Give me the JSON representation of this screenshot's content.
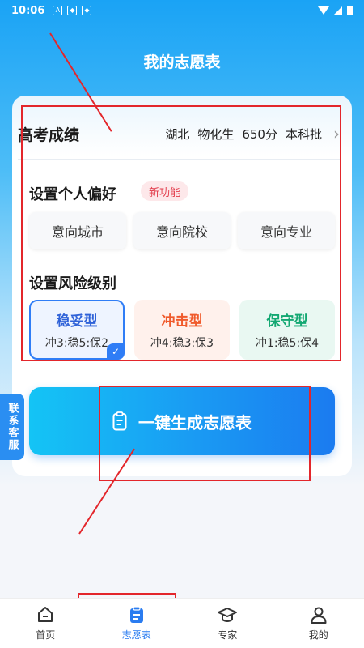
{
  "status_bar": {
    "time": "10:06"
  },
  "page_title": "我的志愿表",
  "score": {
    "label": "高考成绩",
    "province": "湖北",
    "subjects": "物化生",
    "points": "650分",
    "batch": "本科批"
  },
  "preferences": {
    "title": "设置个人偏好",
    "badge": "新功能",
    "options": [
      "意向城市",
      "意向院校",
      "意向专业"
    ]
  },
  "risk": {
    "title": "设置风险级别",
    "levels": [
      {
        "name": "稳妥型",
        "ratio": "冲3:稳5:保2",
        "selected": true
      },
      {
        "name": "冲击型",
        "ratio": "冲4:稳3:保3",
        "selected": false
      },
      {
        "name": "保守型",
        "ratio": "冲1:稳5:保4",
        "selected": false
      }
    ]
  },
  "generate_button": "一键生成志愿表",
  "contact_tab": "联系客服",
  "tabbar": [
    {
      "label": "首页",
      "icon": "home-icon",
      "active": false
    },
    {
      "label": "志愿表",
      "icon": "clipboard-icon",
      "active": true
    },
    {
      "label": "专家",
      "icon": "graduation-cap-icon",
      "active": false
    },
    {
      "label": "我的",
      "icon": "user-icon",
      "active": false
    }
  ],
  "colors": {
    "accent": "#2a7cf0",
    "annotation": "#e3262b",
    "stable": "#2f62d8",
    "aggressive": "#f05a2b",
    "conservative": "#13a872"
  }
}
